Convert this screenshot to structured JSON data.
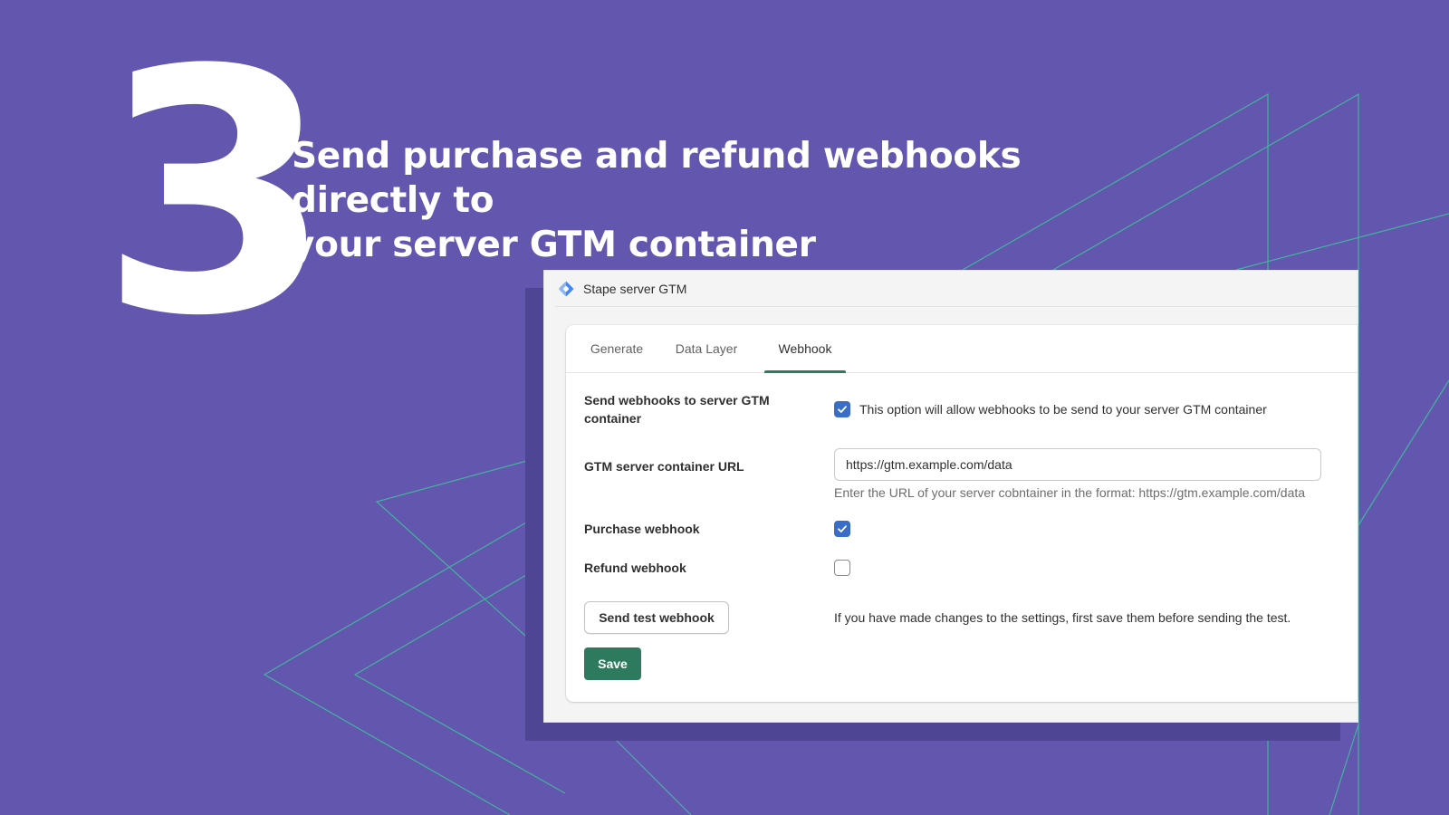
{
  "slide": {
    "step_number": "3",
    "headline_line1": "Send purchase and refund webhooks directly to",
    "headline_line2": "your server GTM container",
    "background_color": "#6256ae",
    "line_color": "#3fc49a"
  },
  "app": {
    "title": "Stape server GTM",
    "icon": "gtm-diamond-icon"
  },
  "tabs": [
    {
      "label": "Generate",
      "active": false
    },
    {
      "label": "Data Layer",
      "active": false
    },
    {
      "label": "Webhook",
      "active": true
    }
  ],
  "form": {
    "send_webhooks": {
      "label_line1": "Send webhooks to server GTM",
      "label_line2": "container",
      "checked": true,
      "description": "This option will allow webhooks to be send to your server GTM container"
    },
    "container_url": {
      "label": "GTM server container URL",
      "value": "https://gtm.example.com/data",
      "help": "Enter the URL of your server cobntainer in the format: https://gtm.example.com/data"
    },
    "purchase_webhook": {
      "label": "Purchase webhook",
      "checked": true
    },
    "refund_webhook": {
      "label": "Refund webhook",
      "checked": false
    },
    "send_test_button": "Send test webhook",
    "test_info": "If you have made changes to the settings, first save them before sending the test.",
    "save_button": "Save"
  },
  "colors": {
    "accent_green": "#2e7a5f",
    "checkbox_blue": "#3a6ec6"
  }
}
